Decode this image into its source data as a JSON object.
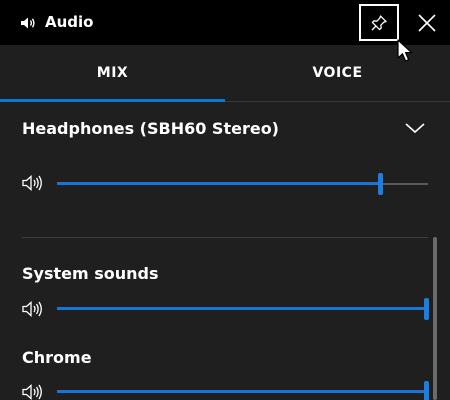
{
  "window": {
    "title": "Audio",
    "title_icon": "speaker-icon",
    "pin_icon": "pin-icon",
    "close_icon": "close-icon"
  },
  "tabs": [
    {
      "label": "MIX",
      "selected": true
    },
    {
      "label": "VOICE",
      "selected": false
    }
  ],
  "device": {
    "name": "Headphones (SBH60 Stereo)",
    "expand_icon": "chevron-down-icon",
    "volume": 0.87
  },
  "apps": [
    {
      "name": "System sounds",
      "volume": 1.0
    },
    {
      "name": "Chrome",
      "volume": 1.0
    }
  ],
  "colors": {
    "accent": "#1a73d6",
    "titlebar": "#000000",
    "background": "#1f1f1f",
    "track": "#5a5a5a"
  }
}
